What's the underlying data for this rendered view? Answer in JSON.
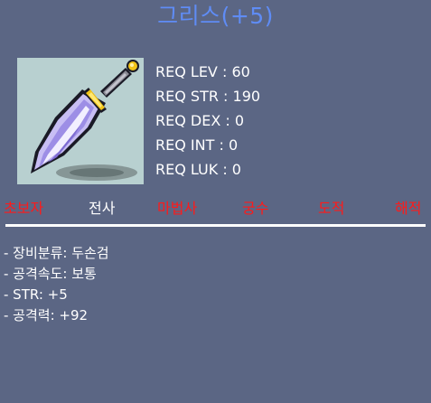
{
  "item": {
    "title": "그리스(+5)",
    "icon": "two-handed-sword-icon"
  },
  "requirements": [
    {
      "label": "REQ LEV",
      "value": "60"
    },
    {
      "label": "REQ STR",
      "value": "190"
    },
    {
      "label": "REQ DEX",
      "value": "0"
    },
    {
      "label": "REQ INT",
      "value": "0"
    },
    {
      "label": "REQ LUK",
      "value": "0"
    }
  ],
  "jobs": [
    {
      "name": "초보자",
      "color": "#ff1a1a"
    },
    {
      "name": "전사",
      "color": "#ffffff"
    },
    {
      "name": "마법사",
      "color": "#ff1a1a"
    },
    {
      "name": "궁수",
      "color": "#ff1a1a"
    },
    {
      "name": "도적",
      "color": "#ff1a1a"
    },
    {
      "name": "해적",
      "color": "#ff1a1a"
    }
  ],
  "stats": [
    "- 장비분류: 두손검",
    "- 공격속도: 보통",
    "- STR: +5",
    "- 공격력: +92"
  ],
  "colors": {
    "background": "#5b6684",
    "title": "#5f8cf5",
    "job_unavailable": "#ff1a1a",
    "job_available": "#ffffff"
  }
}
